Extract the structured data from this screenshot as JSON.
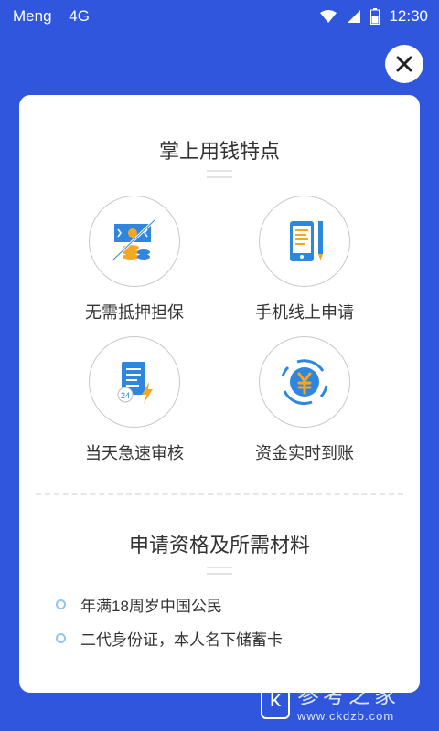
{
  "status": {
    "carrier": "Meng",
    "network": "4G",
    "time": "12:30"
  },
  "title_features": "掌上用钱特点",
  "features": [
    {
      "label": "无需抵押担保",
      "icon": "money-stack-icon"
    },
    {
      "label": "手机线上申请",
      "icon": "phone-pen-icon"
    },
    {
      "label": "当天急速审核",
      "icon": "document-24h-icon"
    },
    {
      "label": "资金实时到账",
      "icon": "yuan-refresh-icon"
    }
  ],
  "title_requirements": "申请资格及所需材料",
  "requirements": [
    "年满18周岁中国公民",
    "二代身份证，本人名下储蓄卡"
  ],
  "watermark": {
    "logo": "k",
    "text": "参考之家",
    "url": "www.ckdzb.com"
  },
  "colors": {
    "background": "#2f56dc",
    "accent": "#2e86de",
    "dot": "#8fc7f0"
  }
}
